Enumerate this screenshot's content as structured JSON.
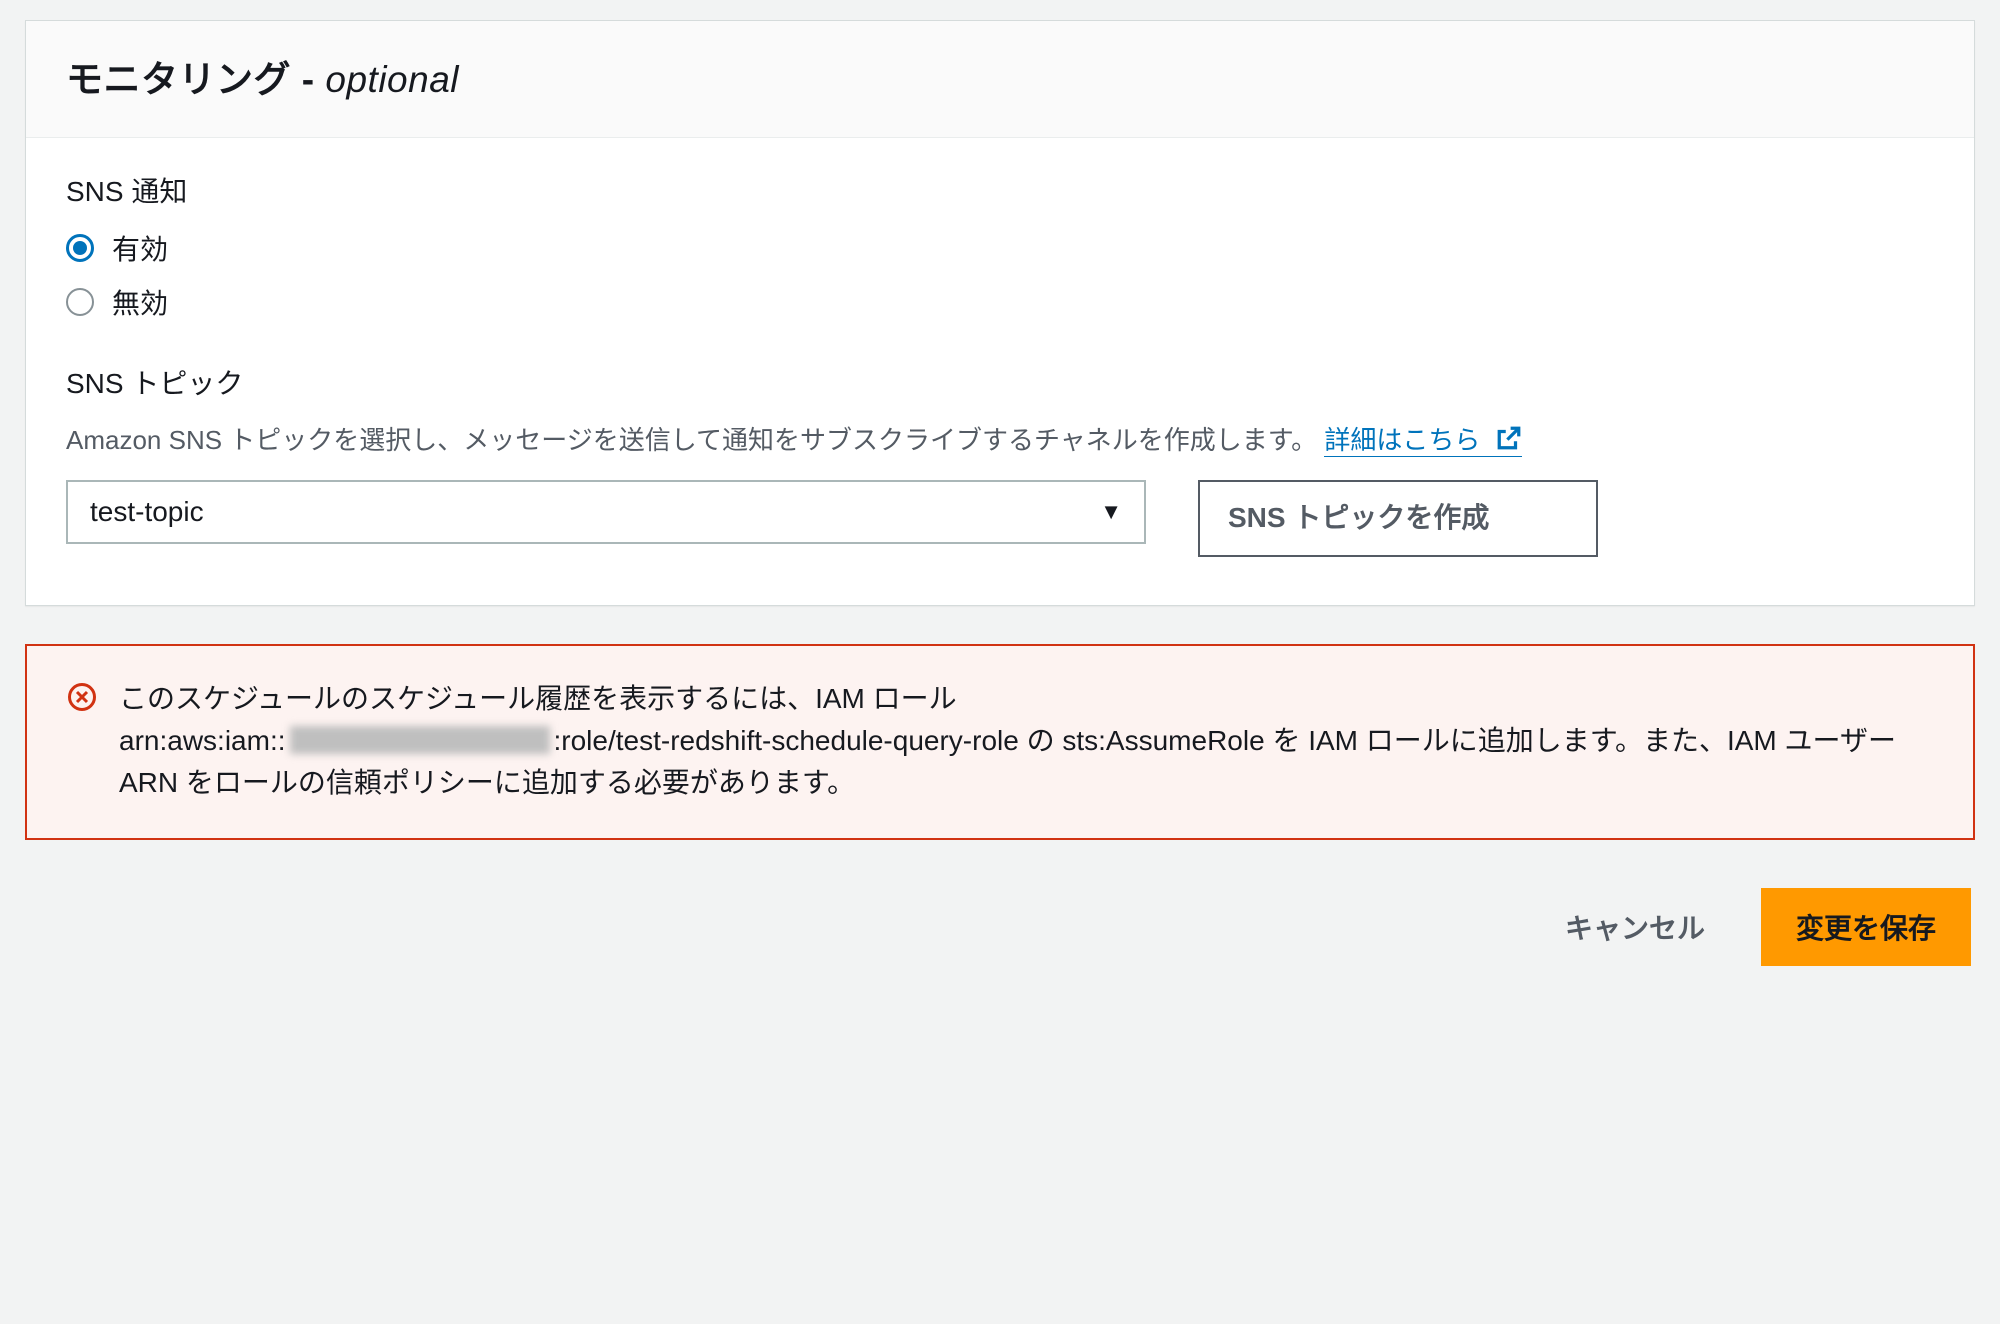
{
  "panel": {
    "title_main": "モニタリング",
    "title_sep": " - ",
    "title_optional": "optional"
  },
  "sns_notify": {
    "label": "SNS 通知",
    "options": {
      "enabled": "有効",
      "disabled": "無効"
    },
    "selected": "enabled"
  },
  "sns_topic": {
    "label": "SNS トピック",
    "description": "Amazon SNS トピックを選択し、メッセージを送信して通知をサブスクライブするチャネルを作成します。",
    "learn_more": "詳細はこちら",
    "selected_value": "test-topic",
    "create_button": "SNS トピックを作成"
  },
  "alert": {
    "line1_before_arn": "このスケジュールのスケジュール履歴を表示するには、IAM ロール",
    "arn_prefix": "arn:aws:iam::",
    "arn_suffix": ":role/test-redshift-schedule-query-role",
    "line2_after_arn": " の sts:AssumeRole を IAM ロールに追加します。また、IAM ユーザー ARN をロールの信頼ポリシーに追加する必要があります。"
  },
  "footer": {
    "cancel": "キャンセル",
    "save": "変更を保存"
  }
}
